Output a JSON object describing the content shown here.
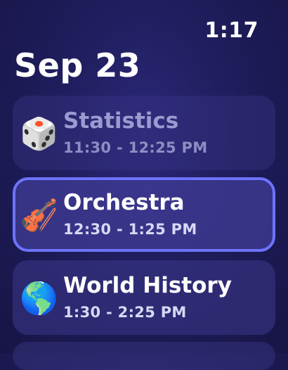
{
  "status": {
    "time": "1:17"
  },
  "date": "Sep 23",
  "events": [
    {
      "title": "Statistics",
      "time": "11:30 - 12:25 PM",
      "icon": "dice-icon",
      "glyph": "🎲"
    },
    {
      "title": "Orchestra",
      "time": "12:30 - 1:25 PM",
      "icon": "violin-icon",
      "glyph": "🎻"
    },
    {
      "title": "World History",
      "time": "1:30 - 2:25 PM",
      "icon": "globe-icon",
      "glyph": "🌎"
    }
  ],
  "colors": {
    "background": "#1f1d5c",
    "card": "#3c388c",
    "selected_border": "#6e73ff",
    "dimmed_text": "#9c9ad0"
  }
}
